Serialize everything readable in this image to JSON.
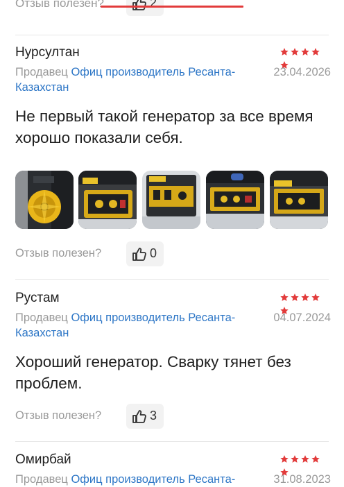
{
  "helpful_label": "Отзыв полезен?",
  "star_color": "#e23b3b",
  "accent_link_color": "#2d76c6",
  "top_partial": {
    "helpful_label": "Отзыв полезен?",
    "count": "2"
  },
  "reviews": [
    {
      "author": "Нурсултан",
      "rating": 5,
      "seller_label": "Продавец",
      "seller_name_line1": "Офиц производитель Ресанта-",
      "seller_name_line2": "Казахстан",
      "date": "23.04.2026",
      "text": "Не первый такой генератор за все время хорошо показали себя.",
      "photos": [
        "generator-photo-1",
        "generator-photo-2",
        "generator-photo-3",
        "generator-photo-4",
        "generator-photo-5"
      ],
      "helpful_count": "0"
    },
    {
      "author": "Рустам",
      "rating": 5,
      "seller_label": "Продавец",
      "seller_name_line1": "Офиц производитель Ресанта-",
      "seller_name_line2": "Казахстан",
      "date": "04.07.2024",
      "text": "Хороший генератор. Сварку тянет без проблем.",
      "helpful_count": "3"
    },
    {
      "author": "Омирбай",
      "rating": 5,
      "seller_label": "Продавец",
      "seller_name_line1": "Офиц производитель Ресанта-",
      "date": "31.08.2023"
    }
  ]
}
